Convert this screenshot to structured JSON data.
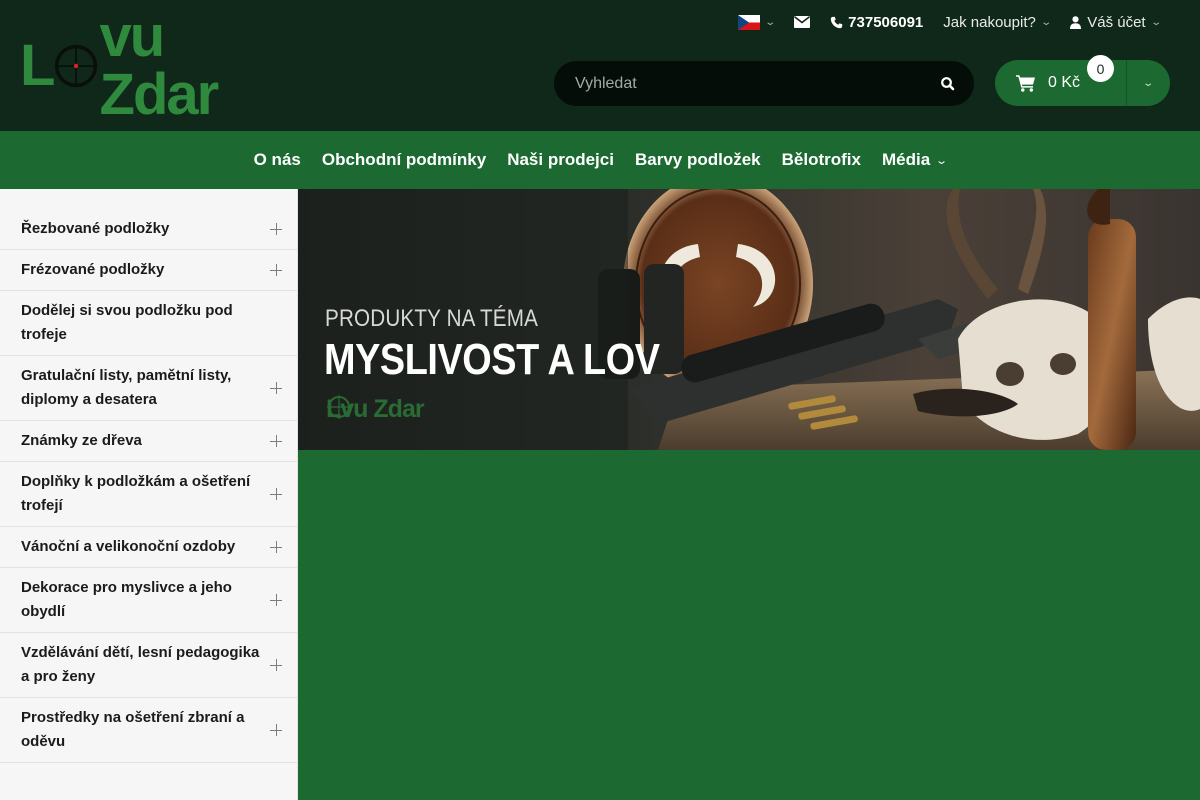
{
  "header": {
    "logo": {
      "letter_before": "L",
      "letters_after": "vu Zdar"
    },
    "topbar": {
      "language": "CZ",
      "phone": "737506091",
      "how_to_buy": "Jak nakoupit?",
      "account": "Váš účet"
    },
    "search": {
      "placeholder": "Vyhledat"
    },
    "cart": {
      "total": "0 Kč",
      "count": "0"
    }
  },
  "nav": {
    "items": [
      {
        "label": "O nás"
      },
      {
        "label": "Obchodní podmínky"
      },
      {
        "label": "Naši prodejci"
      },
      {
        "label": "Barvy podložek"
      },
      {
        "label": "Bělotrofix"
      },
      {
        "label": "Média"
      }
    ]
  },
  "sidebar": {
    "items": [
      {
        "label": "Řezbované podložky"
      },
      {
        "label": "Frézované podložky"
      },
      {
        "label": "Dodělej si svou podložku pod trofeje"
      },
      {
        "label": "Gratulační listy, pamětní listy, diplomy a desatera"
      },
      {
        "label": "Známky ze dřeva"
      },
      {
        "label": "Doplňky k podložkám a ošetření trofejí"
      },
      {
        "label": "Vánoční a velikonoční ozdoby"
      },
      {
        "label": "Dekorace pro myslivce a jeho obydlí"
      },
      {
        "label": "Vzdělávání dětí, lesní pedagogika a pro ženy"
      },
      {
        "label": "Prostředky na ošetření zbraní a oděvu"
      }
    ]
  },
  "banner": {
    "subtitle": "PRODUKTY NA TÉMA",
    "title": "MYSLIVOST A LOV",
    "logo_before": "L",
    "logo_after": "vu Zdar"
  },
  "colors": {
    "header_bg": "#10281a",
    "brand_green": "#1c6a31",
    "logo_green": "#2f8a3e"
  }
}
